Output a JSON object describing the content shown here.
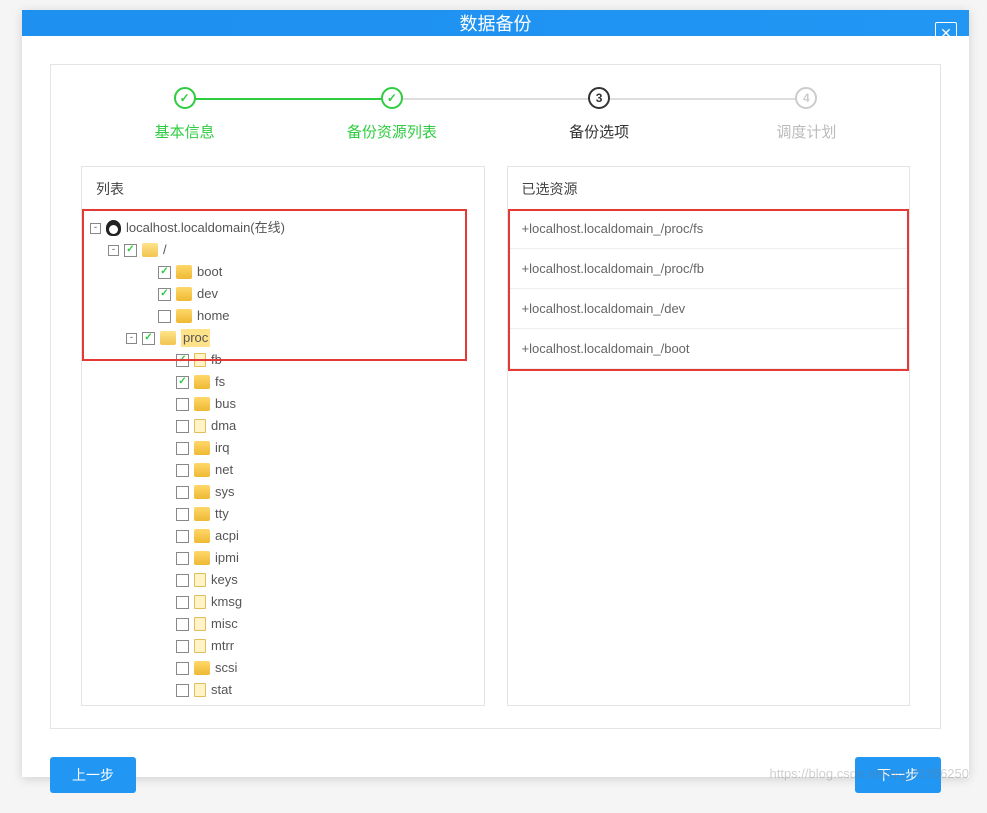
{
  "modal": {
    "title": "数据备份"
  },
  "steps": [
    {
      "label": "基本信息",
      "state": "done",
      "mark": "✓"
    },
    {
      "label": "备份资源列表",
      "state": "done",
      "mark": "✓"
    },
    {
      "label": "备份选项",
      "state": "active",
      "mark": "3"
    },
    {
      "label": "调度计划",
      "state": "pending",
      "mark": "4"
    }
  ],
  "leftPanel": {
    "title": "列表"
  },
  "rightPanel": {
    "title": "已选资源"
  },
  "tree": {
    "root": {
      "label": "localhost.localdomain(在线)",
      "expanded": true,
      "icon": "penguin"
    },
    "rootfs": {
      "label": "/",
      "checked": true,
      "expanded": true
    },
    "level1": [
      {
        "label": "boot",
        "checked": true,
        "icon": "folder"
      },
      {
        "label": "dev",
        "checked": true,
        "icon": "folder"
      },
      {
        "label": "home",
        "checked": false,
        "icon": "folder"
      }
    ],
    "proc": {
      "label": "proc",
      "checked": true,
      "expanded": true,
      "highlight": true
    },
    "procChildren": [
      {
        "label": "fb",
        "checked": true,
        "icon": "file"
      },
      {
        "label": "fs",
        "checked": true,
        "icon": "folder"
      },
      {
        "label": "bus",
        "checked": false,
        "icon": "folder"
      },
      {
        "label": "dma",
        "checked": false,
        "icon": "file"
      },
      {
        "label": "irq",
        "checked": false,
        "icon": "folder"
      },
      {
        "label": "net",
        "checked": false,
        "icon": "folder"
      },
      {
        "label": "sys",
        "checked": false,
        "icon": "folder"
      },
      {
        "label": "tty",
        "checked": false,
        "icon": "folder"
      },
      {
        "label": "acpi",
        "checked": false,
        "icon": "folder"
      },
      {
        "label": "ipmi",
        "checked": false,
        "icon": "folder"
      },
      {
        "label": "keys",
        "checked": false,
        "icon": "file"
      },
      {
        "label": "kmsg",
        "checked": false,
        "icon": "file"
      },
      {
        "label": "misc",
        "checked": false,
        "icon": "file"
      },
      {
        "label": "mtrr",
        "checked": false,
        "icon": "file"
      },
      {
        "label": "scsi",
        "checked": false,
        "icon": "folder"
      },
      {
        "label": "stat",
        "checked": false,
        "icon": "file"
      }
    ]
  },
  "selected": [
    "+localhost.localdomain_/proc/fs",
    "+localhost.localdomain_/proc/fb",
    "+localhost.localdomain_/dev",
    "+localhost.localdomain_/boot"
  ],
  "buttons": {
    "prev": "上一步",
    "next": "下一步"
  },
  "watermark": "https://blog.csdn.net/qq_41356250"
}
